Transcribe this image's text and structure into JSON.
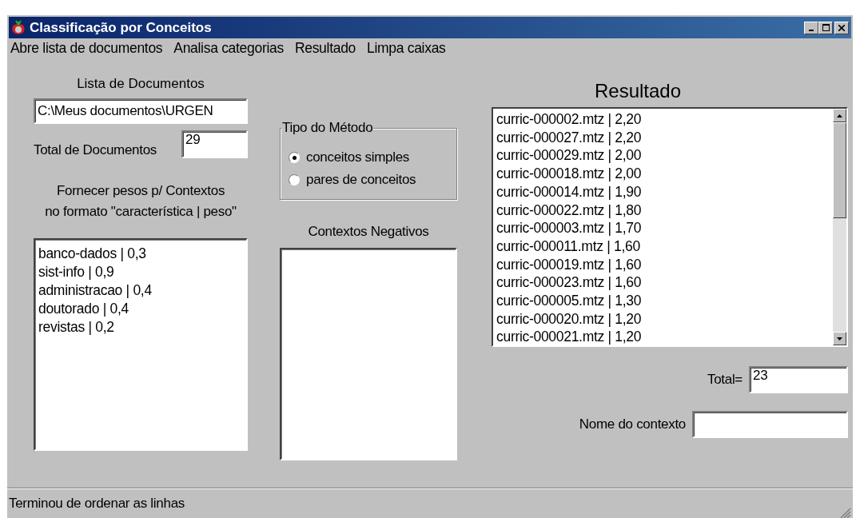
{
  "window": {
    "title": "Classificação por Conceitos"
  },
  "menu": [
    "Abre lista de documentos",
    "Analisa categorias",
    "Resultado",
    "Limpa caixas"
  ],
  "documents": {
    "label": "Lista de Documentos",
    "path": "C:\\Meus documentos\\URGEN",
    "total_label": "Total de Documentos",
    "total": "29"
  },
  "weights": {
    "label_lines": [
      "Fornecer pesos p/ Contextos",
      "no formato \"característica | peso\""
    ],
    "lines": [
      "banco-dados | 0,3",
      "sist-info | 0,9",
      "administracao | 0,4",
      "doutorado | 0,4",
      "revistas | 0,2"
    ]
  },
  "method": {
    "title": "Tipo do Método",
    "options": [
      {
        "label": "conceitos simples",
        "selected": true
      },
      {
        "label": "pares de conceitos",
        "selected": false
      }
    ]
  },
  "negative": {
    "label": "Contextos Negativos"
  },
  "result": {
    "title": "Resultado",
    "items": [
      "curric-000002.mtz | 2,20",
      "curric-000027.mtz | 2,20",
      "curric-000029.mtz | 2,00",
      "curric-000018.mtz | 2,00",
      "curric-000014.mtz | 1,90",
      "curric-000022.mtz | 1,80",
      "curric-000003.mtz | 1,70",
      "curric-000011.mtz | 1,60",
      "curric-000019.mtz | 1,60",
      "curric-000023.mtz | 1,60",
      "curric-000005.mtz | 1,30",
      "curric-000020.mtz | 1,20",
      "curric-000021.mtz | 1,20"
    ],
    "total_label": "Total=",
    "total": "23",
    "context_label": "Nome do contexto"
  },
  "status_bar": "Terminou de ordenar as linhas"
}
